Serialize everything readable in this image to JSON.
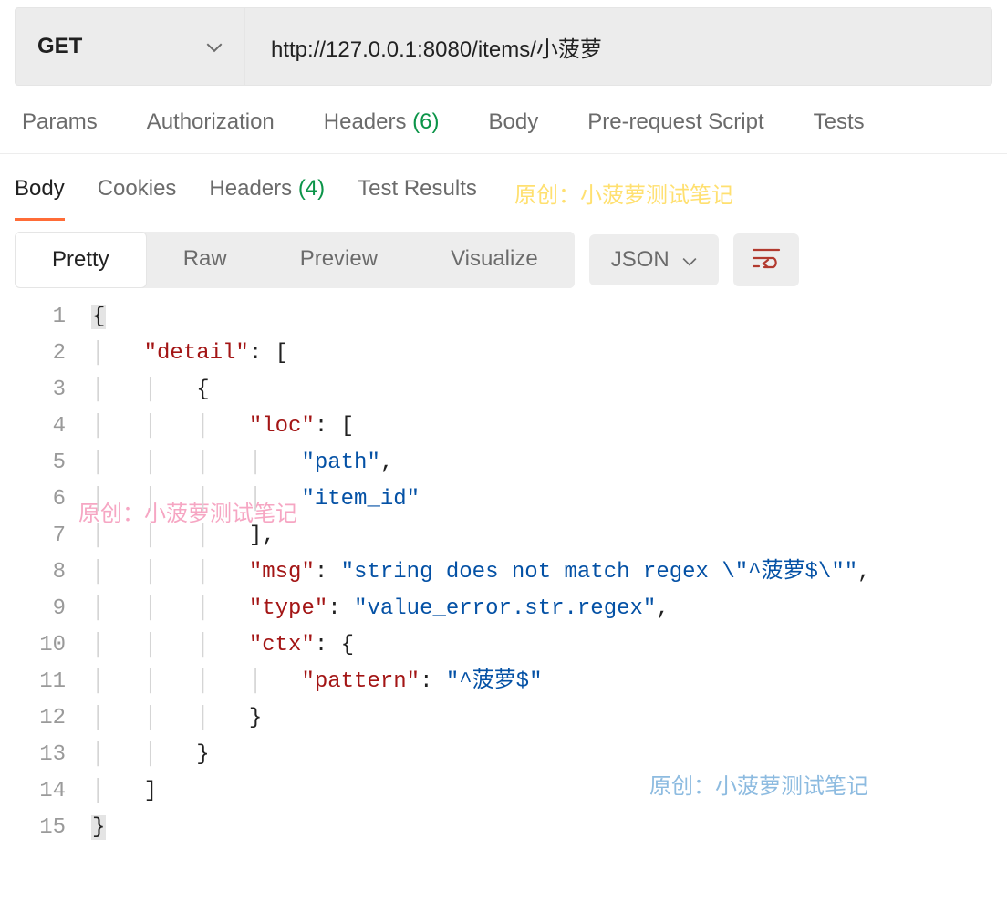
{
  "request": {
    "method": "GET",
    "url": "http://127.0.0.1:8080/items/小菠萝"
  },
  "request_tabs": {
    "params": "Params",
    "authorization": "Authorization",
    "headers_label": "Headers ",
    "headers_count": "(6)",
    "body": "Body",
    "prerequest": "Pre-request Script",
    "tests": "Tests"
  },
  "response_tabs": {
    "body": "Body",
    "cookies": "Cookies",
    "headers_label": "Headers ",
    "headers_count": "(4)",
    "test_results": "Test Results"
  },
  "view_modes": {
    "pretty": "Pretty",
    "raw": "Raw",
    "preview": "Preview",
    "visualize": "Visualize"
  },
  "format_dropdown": "JSON",
  "code": {
    "line1_open": "{",
    "line2_key": "\"detail\"",
    "line2_rest": ": [",
    "line3": "{",
    "line4_key": "\"loc\"",
    "line4_rest": ": [",
    "line5_val": "\"path\"",
    "line5_comma": ",",
    "line6_val": "\"item_id\"",
    "line7": "],",
    "line8_key": "\"msg\"",
    "line8_sep": ": ",
    "line8_val": "\"string does not match regex \\\"^菠萝$\\\"\"",
    "line8_comma": ",",
    "line9_key": "\"type\"",
    "line9_sep": ": ",
    "line9_val": "\"value_error.str.regex\"",
    "line9_comma": ",",
    "line10_key": "\"ctx\"",
    "line10_rest": ": {",
    "line11_key": "\"pattern\"",
    "line11_sep": ": ",
    "line11_val": "\"^菠萝$\"",
    "line12": "}",
    "line13": "}",
    "line14": "]",
    "line15_close": "}"
  },
  "line_numbers": [
    "1",
    "2",
    "3",
    "4",
    "5",
    "6",
    "7",
    "8",
    "9",
    "10",
    "11",
    "12",
    "13",
    "14",
    "15"
  ],
  "watermarks": {
    "text": "原创：小菠萝测试笔记"
  }
}
